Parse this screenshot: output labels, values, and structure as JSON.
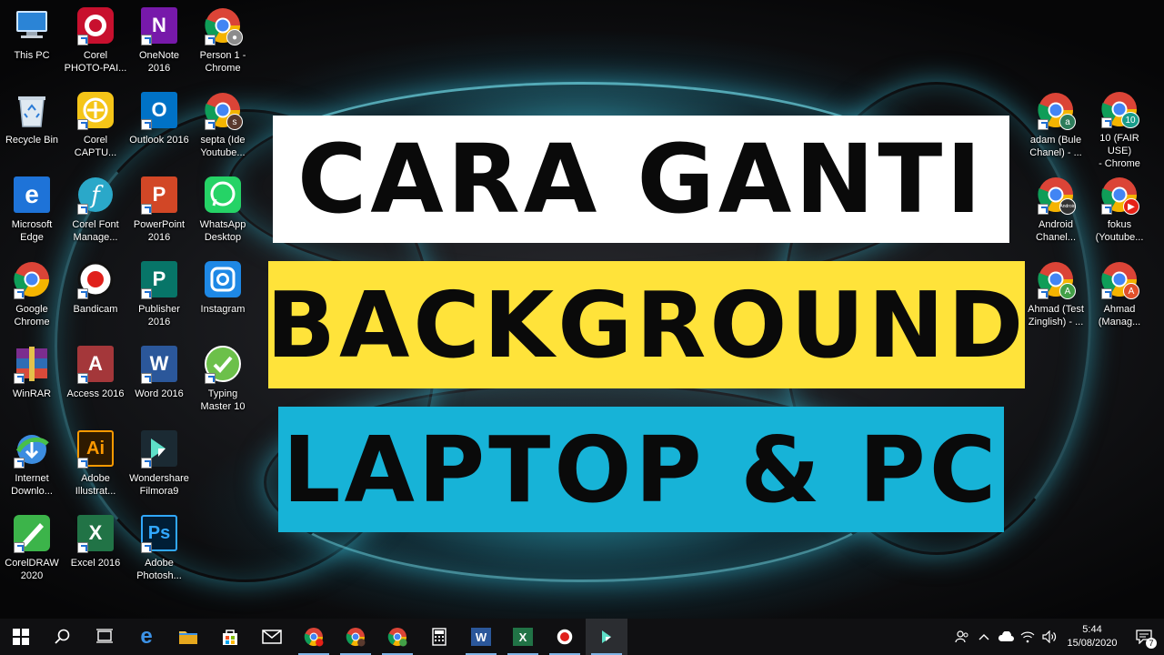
{
  "desktop": {
    "icons": [
      {
        "id": "this-pc",
        "label": "This PC",
        "icon": "computer-icon"
      },
      {
        "id": "corel-photo-paint",
        "label": "Corel\nPHOTO-PAI...",
        "icon": "corel-photo-paint-icon"
      },
      {
        "id": "onenote-2016",
        "label": "OneNote\n2016",
        "icon": "onenote-icon"
      },
      {
        "id": "person1-chrome",
        "label": "Person 1 -\nChrome",
        "icon": "chrome-icon"
      },
      {
        "id": "recycle-bin",
        "label": "Recycle Bin",
        "icon": "recycle-bin-icon"
      },
      {
        "id": "corel-capture",
        "label": "Corel\nCAPTU...",
        "icon": "corel-capture-icon"
      },
      {
        "id": "outlook-2016",
        "label": "Outlook 2016",
        "icon": "outlook-icon"
      },
      {
        "id": "septa-chrome",
        "label": "septa (Ide\nYoutube...",
        "icon": "chrome-icon",
        "badge": "s"
      },
      {
        "id": "microsoft-edge",
        "label": "Microsoft\nEdge",
        "icon": "edge-icon"
      },
      {
        "id": "corel-font-manager",
        "label": "Corel Font\nManage...",
        "icon": "corel-font-icon"
      },
      {
        "id": "powerpoint-2016",
        "label": "PowerPoint\n2016",
        "icon": "powerpoint-icon"
      },
      {
        "id": "whatsapp-desktop",
        "label": "WhatsApp\nDesktop",
        "icon": "whatsapp-icon"
      },
      {
        "id": "google-chrome",
        "label": "Google\nChrome",
        "icon": "chrome-icon"
      },
      {
        "id": "bandicam",
        "label": "Bandicam",
        "icon": "bandicam-icon"
      },
      {
        "id": "publisher-2016",
        "label": "Publisher\n2016",
        "icon": "publisher-icon"
      },
      {
        "id": "instagram",
        "label": "Instagram",
        "icon": "instagram-icon"
      },
      {
        "id": "winrar",
        "label": "WinRAR",
        "icon": "winrar-icon"
      },
      {
        "id": "access-2016",
        "label": "Access 2016",
        "icon": "access-icon"
      },
      {
        "id": "word-2016",
        "label": "Word 2016",
        "icon": "word-icon"
      },
      {
        "id": "typing-master",
        "label": "Typing\nMaster 10",
        "icon": "typing-master-icon"
      },
      {
        "id": "internet-download",
        "label": "Internet\nDownlo...",
        "icon": "idm-icon"
      },
      {
        "id": "adobe-illustrator",
        "label": "Adobe\nIllustrat...",
        "icon": "illustrator-icon"
      },
      {
        "id": "filmora9",
        "label": "Wondershare\nFilmora9",
        "icon": "filmora-icon"
      },
      {
        "id": "coreldraw-2020",
        "label": "CorelDRAW\n2020",
        "icon": "coreldraw-icon"
      },
      {
        "id": "excel-2016",
        "label": "Excel 2016",
        "icon": "excel-icon"
      },
      {
        "id": "adobe-photoshop",
        "label": "Adobe\nPhotosh...",
        "icon": "photoshop-icon"
      }
    ],
    "right_icons": [
      {
        "id": "adam-chrome",
        "label": "adam (Bule\nChanel) - ...",
        "icon": "chrome-icon",
        "badge": "a"
      },
      {
        "id": "fair-use-chrome",
        "label": "10 (FAIR USE)\n- Chrome",
        "icon": "chrome-icon",
        "badge": "10"
      },
      {
        "id": "android-chrome",
        "label": "Android\nChanel...",
        "icon": "chrome-icon",
        "badge": "Android"
      },
      {
        "id": "fokus-chrome",
        "label": "fokus\n(Youtube...",
        "icon": "chrome-icon",
        "badge": "yt"
      },
      {
        "id": "ahmad-test-chrome",
        "label": "Ahmad (Test\nZinglish) - ...",
        "icon": "chrome-icon",
        "badge": "A"
      },
      {
        "id": "ahmad-manag-chrome",
        "label": "Ahmad\n(Manag...",
        "icon": "chrome-icon",
        "badge": "A"
      }
    ]
  },
  "banners": {
    "line1": "CARA GANTI",
    "line2": "BACKGROUND",
    "line3": "LAPTOP & PC"
  },
  "taskbar": {
    "apps": [
      "start-icon",
      "search-icon",
      "task-view-icon",
      "edge-icon",
      "file-explorer-icon",
      "store-icon",
      "mail-icon",
      "chrome-icon",
      "chrome-icon",
      "chrome-icon",
      "calculator-icon",
      "word-icon",
      "excel-icon",
      "bandicam-icon",
      "filmora-icon"
    ],
    "time": "5:44",
    "date": "15/08/2020",
    "notification_count": "7"
  },
  "colors": {
    "banner1": "#ffffff",
    "banner2": "#ffe33a",
    "banner3": "#17b3d7",
    "taskbar": "#101012"
  }
}
